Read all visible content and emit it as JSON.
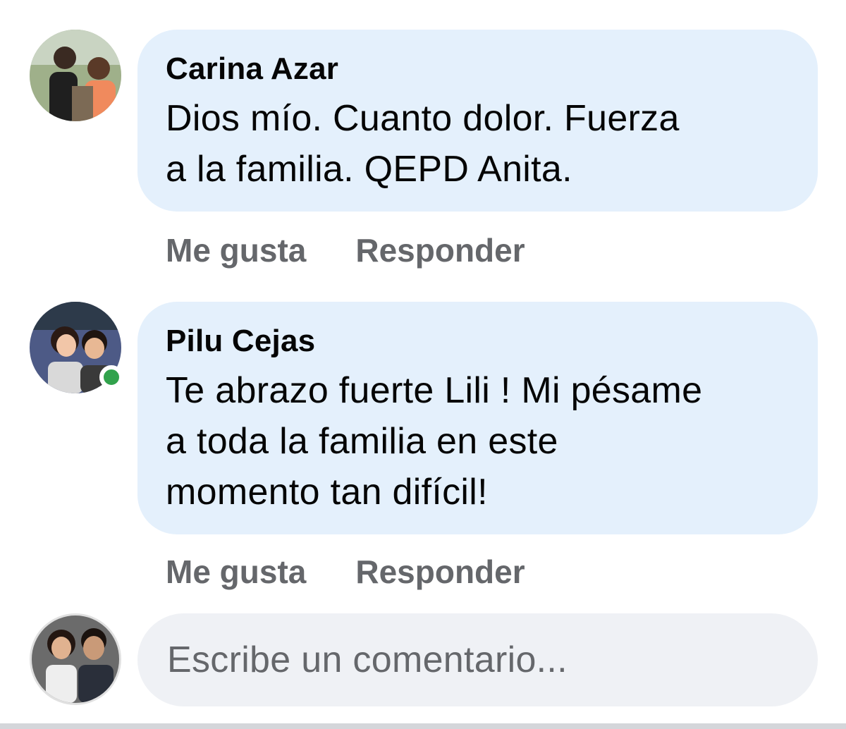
{
  "comments": [
    {
      "author": "Carina Azar",
      "text_lines": [
        "Dios mío.  Cuanto dolor. Fuerza",
        "a la familia. QEPD Anita."
      ],
      "like_label": "Me gusta",
      "reply_label": "Responder",
      "online": false,
      "avatar_icon": "user-photo-avatar"
    },
    {
      "author": "Pilu Cejas",
      "text_lines": [
        "Te abrazo fuerte Lili ! Mi pésame",
        "a toda la familia en este",
        "momento tan difícil!"
      ],
      "like_label": "Me gusta",
      "reply_label": "Responder",
      "online": true,
      "avatar_icon": "user-photo-avatar"
    }
  ],
  "composer": {
    "placeholder": "Escribe un comentario...",
    "avatar_icon": "current-user-avatar"
  },
  "colors": {
    "bubble": "#e4f0fc",
    "composer_bg": "#eff1f5",
    "action_text": "#65676b",
    "online": "#31a24c"
  }
}
